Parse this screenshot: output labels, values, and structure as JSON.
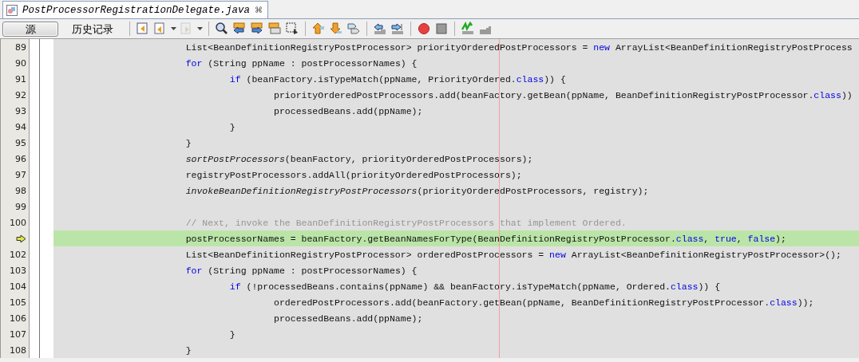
{
  "editor_tab": {
    "title": "PostProcessorRegistrationDelegate.java",
    "close": "⌘"
  },
  "view_tabs": [
    {
      "label": "源",
      "selected": true
    },
    {
      "label": "历史记录",
      "selected": false
    }
  ],
  "code_lines": [
    {
      "number": "89",
      "current": false,
      "tokens": [
        {
          "text": "                        List<BeanDefinitionRegistryPostProcessor> priorityOrderedPostProcessors = ",
          "kind": "plain"
        },
        {
          "text": "new",
          "kind": "keyword"
        },
        {
          "text": " ArrayList<BeanDefinitionRegistryPostProcess",
          "kind": "plain"
        }
      ]
    },
    {
      "number": "90",
      "current": false,
      "tokens": [
        {
          "text": "                        for",
          "kind": "keyword"
        },
        {
          "text": " (String ppName : postProcessorNames) {",
          "kind": "plain"
        }
      ]
    },
    {
      "number": "91",
      "current": false,
      "tokens": [
        {
          "text": "                                if",
          "kind": "keyword"
        },
        {
          "text": " (beanFactory.isTypeMatch(ppName, PriorityOrdered.",
          "kind": "plain"
        },
        {
          "text": "class",
          "kind": "keyword"
        },
        {
          "text": ")) {",
          "kind": "plain"
        }
      ]
    },
    {
      "number": "92",
      "current": false,
      "tokens": [
        {
          "text": "                                        priorityOrderedPostProcessors.add(beanFactory.getBean(ppName, BeanDefinitionRegistryPostProcessor.",
          "kind": "plain"
        },
        {
          "text": "class",
          "kind": "keyword"
        },
        {
          "text": "))",
          "kind": "plain"
        }
      ]
    },
    {
      "number": "93",
      "current": false,
      "tokens": [
        {
          "text": "                                        processedBeans.add(ppName);",
          "kind": "plain"
        }
      ]
    },
    {
      "number": "94",
      "current": false,
      "tokens": [
        {
          "text": "                                }",
          "kind": "plain"
        }
      ]
    },
    {
      "number": "95",
      "current": false,
      "tokens": [
        {
          "text": "                        }",
          "kind": "plain"
        }
      ]
    },
    {
      "number": "96",
      "current": false,
      "tokens": [
        {
          "text": "                        sortPostProcessors",
          "kind": "static"
        },
        {
          "text": "(beanFactory, priorityOrderedPostProcessors);",
          "kind": "plain"
        }
      ]
    },
    {
      "number": "97",
      "current": false,
      "tokens": [
        {
          "text": "                        registryPostProcessors.addAll(priorityOrderedPostProcessors);",
          "kind": "plain"
        }
      ]
    },
    {
      "number": "98",
      "current": false,
      "tokens": [
        {
          "text": "                        invokeBeanDefinitionRegistryPostProcessors",
          "kind": "static"
        },
        {
          "text": "(priorityOrderedPostProcessors, registry);",
          "kind": "plain"
        }
      ]
    },
    {
      "number": "99",
      "current": false
    },
    {
      "number": "100",
      "current": false,
      "tokens": [
        {
          "text": "                        // Next, invoke the BeanDefinitionRegistryPostProcessors that implement Ordered.",
          "kind": "comment"
        }
      ]
    },
    {
      "current": true,
      "tokens": [
        {
          "text": "                        postProcessorNames = beanFactory.getBeanNamesForType(BeanDefinitionRegistryPostProcessor.",
          "kind": "plain"
        },
        {
          "text": "class",
          "kind": "keyword"
        },
        {
          "text": ", ",
          "kind": "plain"
        },
        {
          "text": "true",
          "kind": "keyword"
        },
        {
          "text": ", ",
          "kind": "plain"
        },
        {
          "text": "false",
          "kind": "keyword"
        },
        {
          "text": ");",
          "kind": "plain"
        }
      ]
    },
    {
      "number": "102",
      "current": false,
      "tokens": [
        {
          "text": "                        List<BeanDefinitionRegistryPostProcessor> orderedPostProcessors = ",
          "kind": "plain"
        },
        {
          "text": "new",
          "kind": "keyword"
        },
        {
          "text": " ArrayList<BeanDefinitionRegistryPostProcessor>();",
          "kind": "plain"
        }
      ]
    },
    {
      "number": "103",
      "current": false,
      "tokens": [
        {
          "text": "                        for",
          "kind": "keyword"
        },
        {
          "text": " (String ppName : postProcessorNames) {",
          "kind": "plain"
        }
      ]
    },
    {
      "number": "104",
      "current": false,
      "tokens": [
        {
          "text": "                                if",
          "kind": "keyword"
        },
        {
          "text": " (!processedBeans.contains(ppName) && beanFactory.isTypeMatch(ppName, Ordered.",
          "kind": "plain"
        },
        {
          "text": "class",
          "kind": "keyword"
        },
        {
          "text": ")) {",
          "kind": "plain"
        }
      ]
    },
    {
      "number": "105",
      "current": false,
      "tokens": [
        {
          "text": "                                        orderedPostProcessors.add(beanFactory.getBean(ppName, BeanDefinitionRegistryPostProcessor.",
          "kind": "plain"
        },
        {
          "text": "class",
          "kind": "keyword"
        },
        {
          "text": "));",
          "kind": "plain"
        }
      ]
    },
    {
      "number": "106",
      "current": false,
      "tokens": [
        {
          "text": "                                        processedBeans.add(ppName);",
          "kind": "plain"
        }
      ]
    },
    {
      "number": "107",
      "current": false,
      "tokens": [
        {
          "text": "                                }",
          "kind": "plain"
        }
      ]
    },
    {
      "number": "108",
      "current": false,
      "tokens": [
        {
          "text": "                        }",
          "kind": "plain"
        }
      ]
    }
  ]
}
